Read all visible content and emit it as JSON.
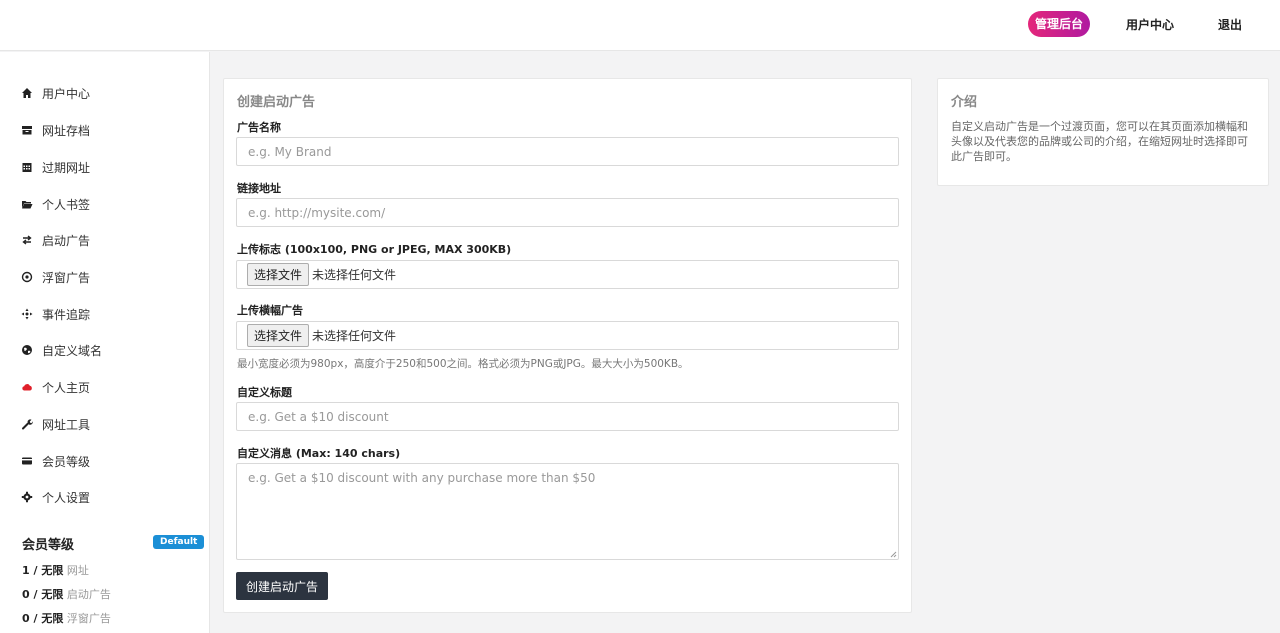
{
  "header": {
    "admin_label": "管理后台",
    "user_center_label": "用户中心",
    "logout_label": "退出"
  },
  "sidebar": {
    "items": [
      {
        "label": "用户中心",
        "icon": "home-icon"
      },
      {
        "label": "网址存档",
        "icon": "archive-icon"
      },
      {
        "label": "过期网址",
        "icon": "calendar-icon"
      },
      {
        "label": "个人书签",
        "icon": "folder-open-icon"
      },
      {
        "label": "启动广告",
        "icon": "swap-icon"
      },
      {
        "label": "浮窗广告",
        "icon": "circle-dot-icon"
      },
      {
        "label": "事件追踪",
        "icon": "crosshair-icon"
      },
      {
        "label": "自定义域名",
        "icon": "globe-icon"
      },
      {
        "label": "个人主页",
        "icon": "cloud-icon"
      },
      {
        "label": "网址工具",
        "icon": "wrench-icon"
      },
      {
        "label": "会员等级",
        "icon": "credit-card-icon"
      },
      {
        "label": "个人设置",
        "icon": "gear-icon"
      }
    ],
    "membership": {
      "title": "会员等级",
      "badge": "Default",
      "stats": [
        {
          "count": "1 / 无限",
          "label": "网址"
        },
        {
          "count": "0 / 无限",
          "label": "启动广告"
        },
        {
          "count": "0 / 无限",
          "label": "浮窗广告"
        }
      ]
    }
  },
  "form": {
    "title": "创建启动广告",
    "name_label": "广告名称",
    "name_placeholder": "e.g. My Brand",
    "link_label": "链接地址",
    "link_placeholder": "e.g. http://mysite.com/",
    "logo_label": "上传标志 (100x100, PNG or JPEG, MAX 300KB)",
    "logo_button": "选择文件",
    "logo_status": "未选择任何文件",
    "banner_label": "上传横幅广告",
    "banner_button": "选择文件",
    "banner_status": "未选择任何文件",
    "banner_help": "最小宽度必须为980px，高度介于250和500之间。格式必须为PNG或JPG。最大大小为500KB。",
    "custom_title_label": "自定义标题",
    "custom_title_placeholder": "e.g. Get a $10 discount",
    "custom_message_label": "自定义消息 (Max: 140 chars)",
    "custom_message_placeholder": "e.g. Get a $10 discount with any purchase more than $50",
    "submit_label": "创建启动广告"
  },
  "intro": {
    "title": "介绍",
    "text": "自定义启动广告是一个过渡页面，您可以在其页面添加横幅和头像以及代表您的品牌或公司的介绍，在缩短网址时选择即可此广告即可。"
  }
}
